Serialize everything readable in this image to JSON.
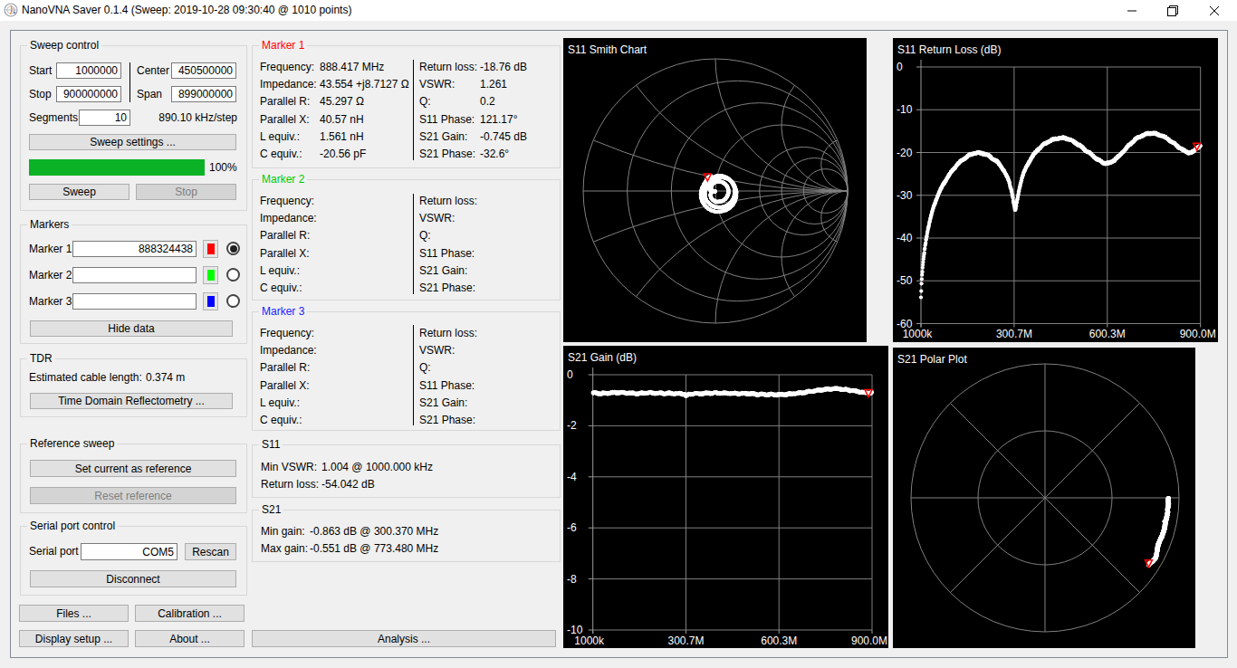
{
  "window": {
    "title": "NanoVNA Saver 0.1.4 (Sweep: 2019-10-28 09:30:40 @ 1010 points)"
  },
  "sweep_control": {
    "title": "Sweep control",
    "start_label": "Start",
    "start_value": "1000000",
    "stop_label": "Stop",
    "stop_value": "900000000",
    "center_label": "Center",
    "center_value": "450500000",
    "span_label": "Span",
    "span_value": "899000000",
    "segments_label": "Segments",
    "segments_value": "10",
    "step_text": "890.10 kHz/step",
    "sweep_settings_button": "Sweep settings ...",
    "progress_percent": "100%",
    "sweep_button": "Sweep",
    "stop_button": "Stop"
  },
  "markers_panel": {
    "title": "Markers",
    "rows": [
      {
        "label": "Marker 1",
        "value": "888324438",
        "color": "#ff0000",
        "selected": true
      },
      {
        "label": "Marker 2",
        "value": "",
        "color": "#00ff00",
        "selected": false
      },
      {
        "label": "Marker 3",
        "value": "",
        "color": "#0000ff",
        "selected": false
      }
    ],
    "hide_data_button": "Hide data"
  },
  "tdr": {
    "title": "TDR",
    "cable_length_label": "Estimated cable length:",
    "cable_length_value": "0.374 m",
    "tdr_button": "Time Domain Reflectometry ..."
  },
  "reference_sweep": {
    "title": "Reference sweep",
    "set_button": "Set current as reference",
    "reset_button": "Reset reference"
  },
  "serial": {
    "title": "Serial port control",
    "port_label": "Serial port",
    "port_value": "COM5",
    "rescan_button": "Rescan",
    "disconnect_button": "Disconnect"
  },
  "bottom_buttons": {
    "files": "Files ...",
    "calibration": "Calibration ...",
    "display_setup": "Display setup ...",
    "about": "About ...",
    "analysis": "Analysis ..."
  },
  "marker_details": [
    {
      "title": "Marker 1",
      "title_color": "#ff0000",
      "left": [
        [
          "Frequency:",
          "888.417 MHz"
        ],
        [
          "Impedance:",
          "43.554 +j8.7127 Ω"
        ],
        [
          "Parallel R:",
          "45.297 Ω"
        ],
        [
          "Parallel X:",
          "40.57 nH"
        ],
        [
          "L equiv.:",
          "1.561 nH"
        ],
        [
          "C equiv.:",
          "-20.56 pF"
        ]
      ],
      "right": [
        [
          "Return loss:",
          "-18.76 dB"
        ],
        [
          "VSWR:",
          "1.261"
        ],
        [
          "Q:",
          "0.2"
        ],
        [
          "S11 Phase:",
          "121.17°"
        ],
        [
          "S21 Gain:",
          "-0.745 dB"
        ],
        [
          "S21 Phase:",
          "-32.6°"
        ]
      ]
    },
    {
      "title": "Marker 2",
      "title_color": "#00cc00",
      "left": [
        [
          "Frequency:",
          ""
        ],
        [
          "Impedance:",
          ""
        ],
        [
          "Parallel R:",
          ""
        ],
        [
          "Parallel X:",
          ""
        ],
        [
          "L equiv.:",
          ""
        ],
        [
          "C equiv.:",
          ""
        ]
      ],
      "right": [
        [
          "Return loss:",
          ""
        ],
        [
          "VSWR:",
          ""
        ],
        [
          "Q:",
          ""
        ],
        [
          "S11 Phase:",
          ""
        ],
        [
          "S21 Gain:",
          ""
        ],
        [
          "S21 Phase:",
          ""
        ]
      ]
    },
    {
      "title": "Marker 3",
      "title_color": "#2121ff",
      "left": [
        [
          "Frequency:",
          ""
        ],
        [
          "Impedance:",
          ""
        ],
        [
          "Parallel R:",
          ""
        ],
        [
          "Parallel X:",
          ""
        ],
        [
          "L equiv.:",
          ""
        ],
        [
          "C equiv.:",
          ""
        ]
      ],
      "right": [
        [
          "Return loss:",
          ""
        ],
        [
          "VSWR:",
          ""
        ],
        [
          "Q:",
          ""
        ],
        [
          "S11 Phase:",
          ""
        ],
        [
          "S21 Gain:",
          ""
        ],
        [
          "S21 Phase:",
          ""
        ]
      ]
    }
  ],
  "s11_info": {
    "title": "S11",
    "rows": [
      [
        "Min VSWR:",
        "1.004 @ 1000.000 kHz"
      ],
      [
        "Return loss:",
        "-54.042 dB"
      ]
    ]
  },
  "s21_info": {
    "title": "S21",
    "rows": [
      [
        "Min gain:",
        "-0.863 dB @ 300.370 MHz"
      ],
      [
        "Max gain:",
        "-0.551 dB @ 773.480 MHz"
      ]
    ]
  },
  "chart_data": [
    {
      "id": "s11_return_loss",
      "type": "line",
      "title": "S11 Return Loss (dB)",
      "x_tick_labels": [
        "1000k",
        "300.7M",
        "600.3M",
        "900.0M"
      ],
      "x_tick_mhz": [
        1,
        300.7,
        600.3,
        900.0
      ],
      "y_tick_labels": [
        "0",
        "-10",
        "-20",
        "-30",
        "-40",
        "-50",
        "-60"
      ],
      "y_ticks": [
        0,
        -10,
        -20,
        -30,
        -40,
        -50,
        -60
      ],
      "xlim_mhz": [
        1,
        900
      ],
      "ylim": [
        -60,
        0
      ],
      "grid": true,
      "point_count": 1010,
      "points": [
        [
          1,
          -54.0
        ],
        [
          3,
          -50.5
        ],
        [
          6,
          -47.5
        ],
        [
          10,
          -44.5
        ],
        [
          15,
          -41.5
        ],
        [
          22,
          -38.5
        ],
        [
          30,
          -35.8
        ],
        [
          45,
          -32.0
        ],
        [
          60,
          -29.3
        ],
        [
          80,
          -26.6
        ],
        [
          100,
          -24.4
        ],
        [
          125,
          -22.3
        ],
        [
          150,
          -20.9
        ],
        [
          168,
          -20.3
        ],
        [
          185,
          -20.1
        ],
        [
          205,
          -20.3
        ],
        [
          228,
          -21.2
        ],
        [
          250,
          -22.5
        ],
        [
          268,
          -24.3
        ],
        [
          283,
          -26.6
        ],
        [
          293,
          -29.2
        ],
        [
          300,
          -32.2
        ],
        [
          304,
          -33.4
        ],
        [
          309,
          -31.8
        ],
        [
          316,
          -29.0
        ],
        [
          326,
          -26.0
        ],
        [
          340,
          -23.4
        ],
        [
          356,
          -21.3
        ],
        [
          375,
          -19.5
        ],
        [
          395,
          -18.2
        ],
        [
          415,
          -17.3
        ],
        [
          435,
          -16.8
        ],
        [
          455,
          -16.6
        ],
        [
          472,
          -16.8
        ],
        [
          490,
          -17.4
        ],
        [
          510,
          -18.3
        ],
        [
          530,
          -19.4
        ],
        [
          550,
          -20.5
        ],
        [
          567,
          -21.5
        ],
        [
          582,
          -22.2
        ],
        [
          595,
          -22.5
        ],
        [
          608,
          -22.4
        ],
        [
          622,
          -21.8
        ],
        [
          638,
          -20.8
        ],
        [
          655,
          -19.5
        ],
        [
          672,
          -18.2
        ],
        [
          690,
          -17.0
        ],
        [
          708,
          -16.2
        ],
        [
          725,
          -15.7
        ],
        [
          740,
          -15.5
        ],
        [
          755,
          -15.6
        ],
        [
          772,
          -16.0
        ],
        [
          790,
          -16.6
        ],
        [
          808,
          -17.5
        ],
        [
          826,
          -18.5
        ],
        [
          843,
          -19.4
        ],
        [
          858,
          -19.9
        ],
        [
          870,
          -20.0
        ],
        [
          880,
          -19.6
        ],
        [
          888,
          -18.9
        ],
        [
          894,
          -18.7
        ],
        [
          900,
          -18.5
        ]
      ],
      "marker": {
        "freq_mhz": 888.417,
        "value": -18.76,
        "color": "#ff0000"
      }
    },
    {
      "id": "s21_gain",
      "type": "line",
      "title": "S21 Gain (dB)",
      "x_tick_labels": [
        "1000k",
        "300.7M",
        "600.3M",
        "900.0M"
      ],
      "x_tick_mhz": [
        1,
        300.7,
        600.3,
        900.0
      ],
      "y_tick_labels": [
        "0",
        "-2",
        "-4",
        "-6",
        "-8",
        "-10"
      ],
      "y_ticks": [
        0,
        -2,
        -4,
        -6,
        -8,
        -10
      ],
      "xlim_mhz": [
        1,
        900
      ],
      "ylim": [
        -10,
        0
      ],
      "grid": true,
      "point_count": 1010,
      "points": [
        [
          1,
          -0.72
        ],
        [
          30,
          -0.73
        ],
        [
          60,
          -0.71
        ],
        [
          90,
          -0.7
        ],
        [
          120,
          -0.72
        ],
        [
          150,
          -0.73
        ],
        [
          180,
          -0.71
        ],
        [
          210,
          -0.72
        ],
        [
          240,
          -0.73
        ],
        [
          270,
          -0.74
        ],
        [
          295,
          -0.76
        ],
        [
          300.4,
          -0.86
        ],
        [
          306,
          -0.79
        ],
        [
          320,
          -0.76
        ],
        [
          350,
          -0.74
        ],
        [
          380,
          -0.72
        ],
        [
          410,
          -0.72
        ],
        [
          440,
          -0.73
        ],
        [
          470,
          -0.74
        ],
        [
          500,
          -0.74
        ],
        [
          530,
          -0.76
        ],
        [
          560,
          -0.77
        ],
        [
          590,
          -0.78
        ],
        [
          620,
          -0.77
        ],
        [
          650,
          -0.74
        ],
        [
          680,
          -0.7
        ],
        [
          710,
          -0.64
        ],
        [
          740,
          -0.59
        ],
        [
          773.5,
          -0.551
        ],
        [
          800,
          -0.56
        ],
        [
          830,
          -0.61
        ],
        [
          855,
          -0.66
        ],
        [
          875,
          -0.7
        ],
        [
          888.4,
          -0.72
        ],
        [
          900,
          -0.7
        ]
      ],
      "marker": {
        "freq_mhz": 888.417,
        "value": -0.745,
        "color": "#ff0000"
      }
    },
    {
      "id": "s11_smith",
      "type": "smith",
      "title": "S11 Smith Chart",
      "grid_resistance_circles": [
        0.2,
        0.5,
        1,
        2,
        3,
        5
      ],
      "grid_reactance_arcs": [
        0.2,
        0.5,
        1,
        2,
        5
      ],
      "mag_from": "s11_return_loss",
      "phase_model": {
        "offset_deg": 1320.53,
        "slope_deg_per_mhz": -1.35
      },
      "point_count": 1010,
      "marker": {
        "freq_mhz": 888.417,
        "mag": 0.1153,
        "phase_deg": 121.17,
        "color": "#ff0000"
      }
    },
    {
      "id": "s21_polar",
      "type": "polar",
      "title": "S21 Polar Plot",
      "grid_circles": [
        1.0,
        0.5
      ],
      "grid_spokes": 8,
      "mag_from": "s21_gain",
      "phase_model": {
        "offset_deg": 0,
        "slope_deg_per_mhz": -0.03672
      },
      "point_count": 1010,
      "marker": {
        "freq_mhz": 888.417,
        "mag": 0.9179,
        "phase_deg": -32.6,
        "color": "#ff0000"
      }
    }
  ]
}
